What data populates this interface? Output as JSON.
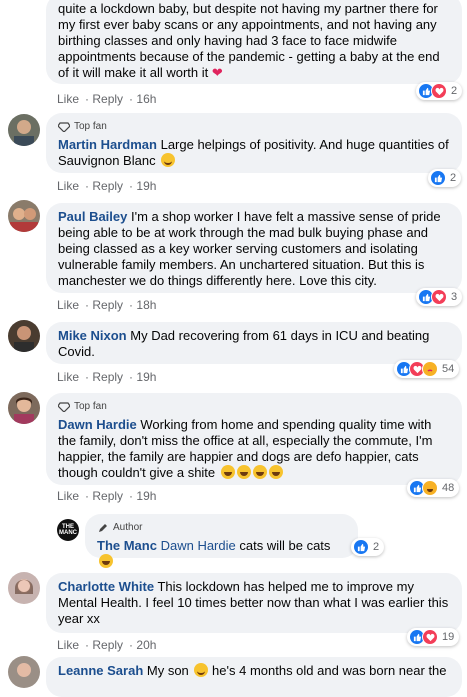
{
  "comments": [
    {
      "text": "quite a lockdown baby, but despite not having my partner there for my first ever baby scans or any appointments, and not having any birthing classes and only having had 3 face to face midwife appointments because of the pandemic - getting a baby at the end of it will make it all worth it",
      "actions": {
        "like": "Like",
        "reply": "Reply",
        "time": "16h"
      },
      "reaction_count": "2"
    },
    {
      "badge": "Top fan",
      "name": "Martin Hardman",
      "text": "Large helpings of positivity. And huge quantities of Sauvignon Blanc",
      "actions": {
        "like": "Like",
        "reply": "Reply",
        "time": "19h"
      },
      "reaction_count": "2"
    },
    {
      "name": "Paul Bailey",
      "text": "I'm a shop worker I have felt a massive sense of pride being able to be at work through the mad bulk buying phase and being classed as a key worker serving customers and isolating vulnerable family members. An unchartered situation. But this is manchester we do things differently here. Love this city.",
      "actions": {
        "like": "Like",
        "reply": "Reply",
        "time": "18h"
      },
      "reaction_count": "3"
    },
    {
      "name": "Mike Nixon",
      "text": "My Dad recovering from 61 days in ICU and beating Covid.",
      "actions": {
        "like": "Like",
        "reply": "Reply",
        "time": "19h"
      },
      "reaction_count": "54"
    },
    {
      "badge": "Top fan",
      "name": "Dawn Hardie",
      "text": "Working from home and spending quality time with the family, don't miss the office at all, especially the commute, I'm happier, the family are happier and dogs are defo happier, cats though couldn't give a shite",
      "actions": {
        "like": "Like",
        "reply": "Reply",
        "time": "19h"
      },
      "reaction_count": "48"
    },
    {
      "badge": "Author",
      "name": "The Manc",
      "mention": "Dawn Hardie",
      "text": "cats will be cats",
      "avatar_text": "THE MANC",
      "reaction_count": "2"
    },
    {
      "name": "Charlotte White",
      "text": "This lockdown has helped me to improve my Mental Health. I feel 10 times better now than what I was earlier this year xx",
      "actions": {
        "like": "Like",
        "reply": "Reply",
        "time": "20h"
      },
      "reaction_count": "19"
    },
    {
      "name": "Leanne Sarah",
      "text_a": "My son",
      "text_b": "he's 4 months old and was born near the"
    }
  ],
  "colors": {
    "like": "#1877f2",
    "love": "#f33e58",
    "haha": "#f7b125",
    "name": "#1c4e8e",
    "bubble": "#f0f2f5"
  },
  "icons": [
    "diamond-icon",
    "pencil-icon",
    "like-reaction-icon",
    "love-reaction-icon",
    "haha-reaction-icon",
    "care-reaction-icon"
  ]
}
